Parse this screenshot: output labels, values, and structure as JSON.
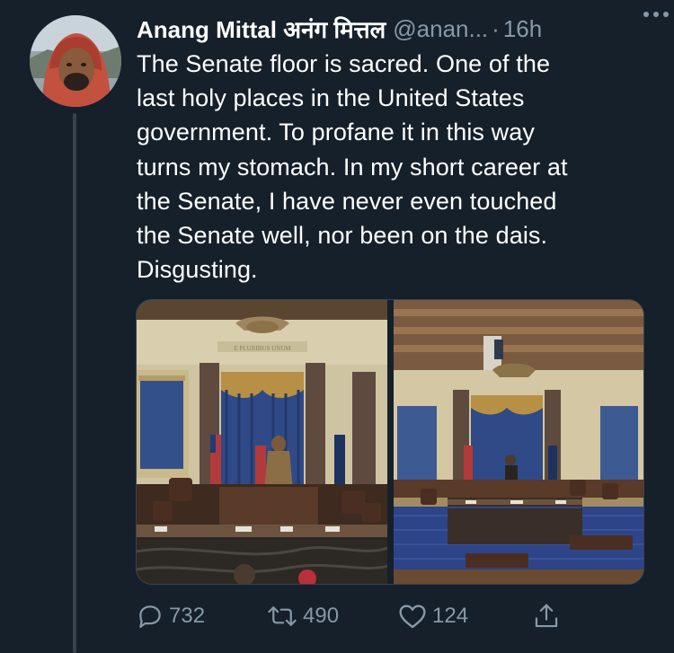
{
  "tweet": {
    "display_name": "Anang Mittal अनंग मित्तल",
    "handle": "@anan...",
    "separator": "·",
    "time": "16h",
    "text_lines": [
      "The Senate floor is sacred. One of the",
      "last holy places in the United States",
      "government. To profane it in this way",
      "turns my stomach. In my short career at",
      "the Senate, I have never even touched",
      "the Senate well, nor been on the dais.",
      "Disgusting."
    ],
    "media_inscription": "E PLURIBUS UNUM"
  },
  "actions": {
    "reply_count": "732",
    "retweet_count": "490",
    "like_count": "124"
  },
  "colors": {
    "background": "#15202b",
    "secondary_text": "#8899a6",
    "divider": "#38444d"
  }
}
